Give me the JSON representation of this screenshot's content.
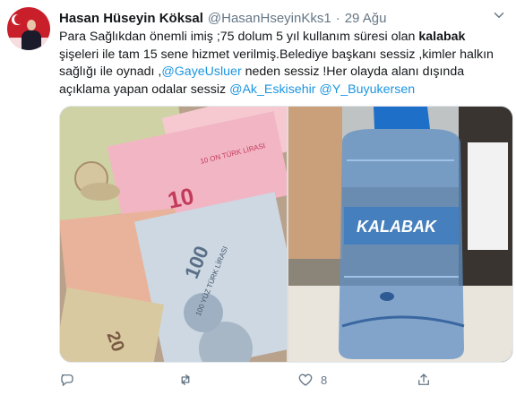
{
  "tweet": {
    "author_name": "Hasan Hüseyin Köksal",
    "author_handle": "@HasanHseyinKks1",
    "separator": "·",
    "date": "29 Ağu",
    "text": {
      "p1": "Para Sağlıkdan önemli imiş ;75 dolum 5 yıl kullanım süresi olan ",
      "bold": "kalabak",
      "p2": " şişeleri ile tam 15 sene hizmet verilmiş.Belediye başkanı sessiz ,kimler halkın sağlığı ile oynadı ,",
      "mention1": "@GayeUsluer",
      "p3": " neden sessiz !Her olayda alanı dışında açıklama yapan odalar sessiz ",
      "mention2": "@Ak_Eskisehir",
      "mention3": "@Y_Buyukersen"
    },
    "images": {
      "left_alt": "Turkish lira banknotes and coins",
      "right_alt": "Kalabak water bottle",
      "bottle_label": "KALABAK",
      "banknote_labels": [
        "10",
        "100",
        "20",
        "10 ON TÜRK LİRASI",
        "100 YÜZ TÜRK LİRASI"
      ]
    },
    "actions": {
      "reply_icon": "reply-icon",
      "retweet_icon": "retweet-icon",
      "like_icon": "heart-icon",
      "like_count": "8",
      "share_icon": "share-icon"
    },
    "colors": {
      "link": "#1b95e0",
      "muted": "#657786"
    }
  }
}
